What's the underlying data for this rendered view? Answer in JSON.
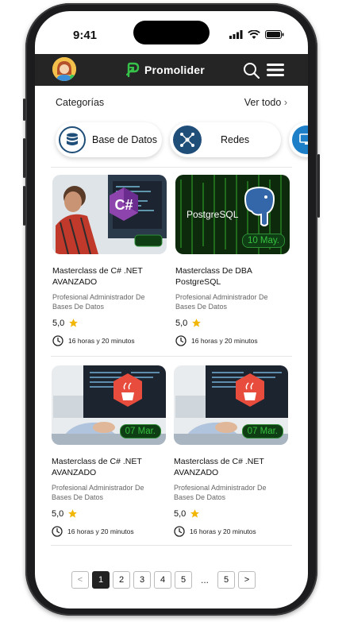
{
  "status": {
    "time": "9:41"
  },
  "appbar": {
    "brand": "Promolider"
  },
  "categories": {
    "title": "Categorías",
    "see_all": "Ver todo",
    "items": [
      {
        "label": "Base de Datos",
        "icon": "database-icon"
      },
      {
        "label": "Redes",
        "icon": "network-icon"
      }
    ]
  },
  "courses": [
    {
      "title": "Masterclass de C# .NET AVANZADO",
      "subtitle": "Profesional Administrador De Bases De Datos",
      "rating": "5,0",
      "duration": "16 horas y 20 minutos",
      "badge": ""
    },
    {
      "title": "Masterclass De DBA PostgreSQL",
      "subtitle": "Profesional Administrador De Bases De Datos",
      "rating": "5,0",
      "duration": "16 horas y 20 minutos",
      "badge": "10 May."
    },
    {
      "title": "Masterclass de C# .NET AVANZADO",
      "subtitle": "Profesional Administrador De Bases De Datos",
      "rating": "5,0",
      "duration": "16 horas y 20 minutos",
      "badge": "07 Mar."
    },
    {
      "title": "Masterclass de C# .NET AVANZADO",
      "subtitle": "Profesional Administrador De Bases De Datos",
      "rating": "5,0",
      "duration": "16 horas y 20 minutos",
      "badge": "07 Mar."
    }
  ],
  "thumb_text": {
    "postgres": "PostgreSQL",
    "csharp": "C#"
  },
  "pagination": {
    "prev": "<",
    "pages": [
      "1",
      "2",
      "3",
      "4",
      "5"
    ],
    "ellipsis": "...",
    "last": "5",
    "next": ">",
    "current": "1"
  },
  "colors": {
    "appbar": "#252526",
    "accent_green": "#35c23e",
    "chip_icon": "#1f4e79",
    "star": "#f2b705"
  }
}
